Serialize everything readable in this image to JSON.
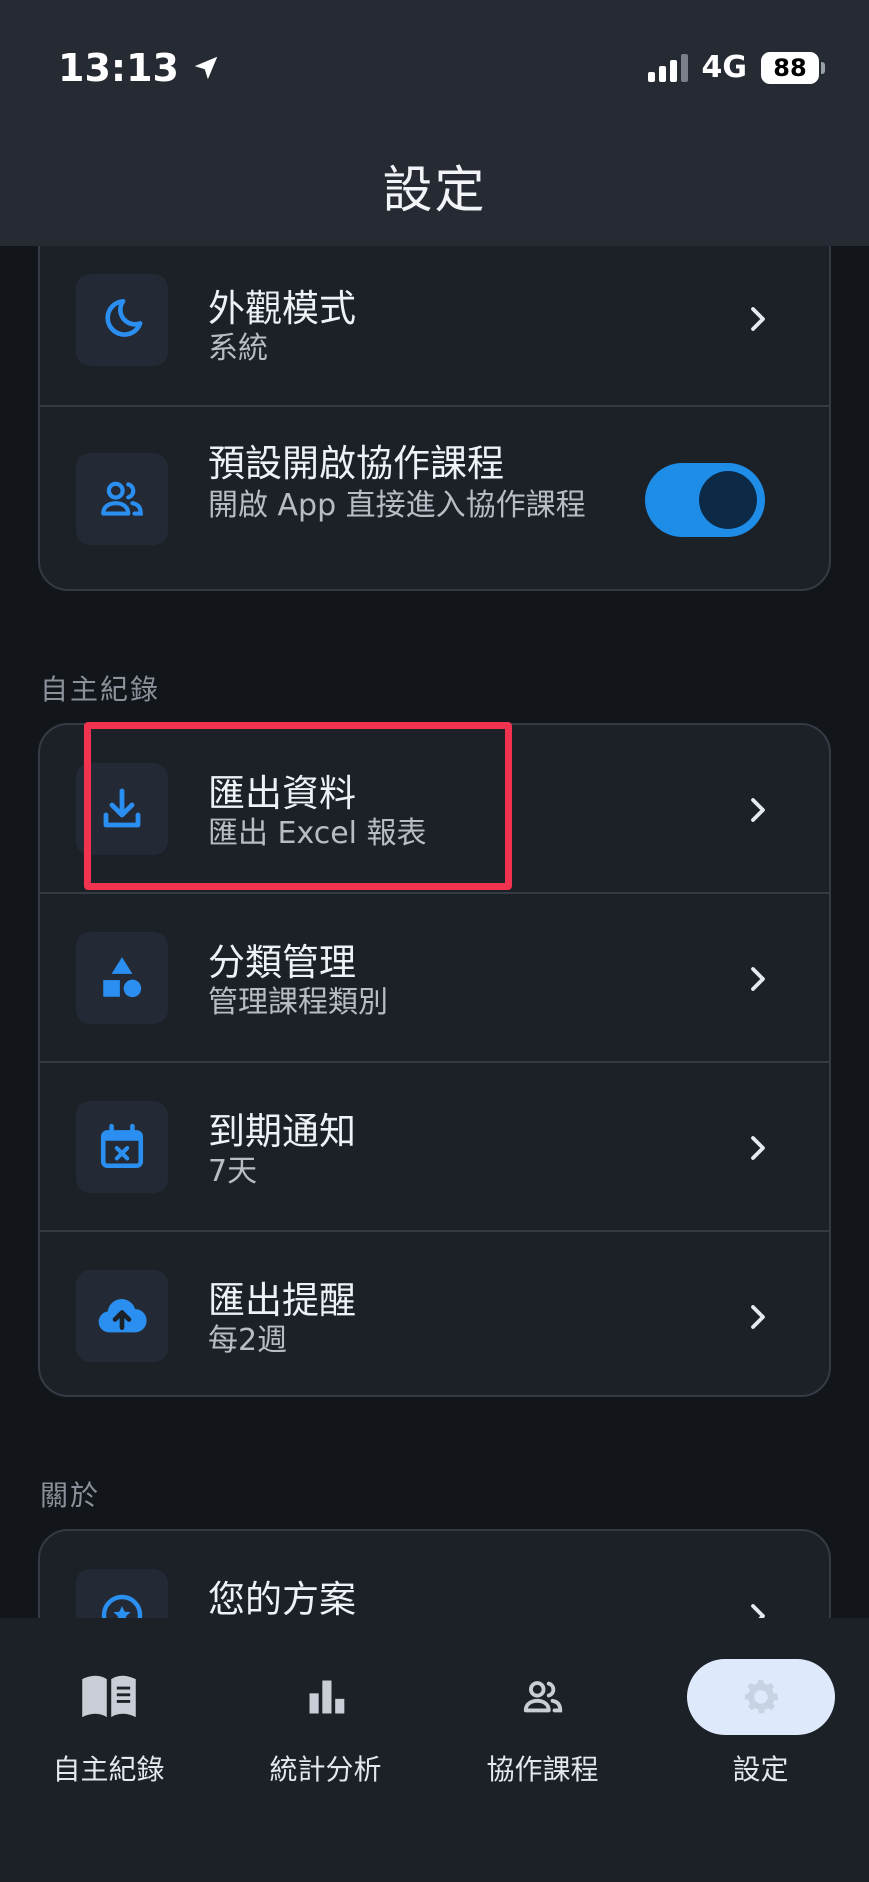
{
  "status_bar": {
    "time": "13:13",
    "network": "4G",
    "battery": "88"
  },
  "header": {
    "title": "設定"
  },
  "top_card": {
    "items": [
      {
        "title": "外觀模式",
        "subtitle": "系統",
        "icon": "moon-icon"
      },
      {
        "title": "預設開啟協作課程",
        "subtitle": "開啟 App 直接進入協作課程",
        "icon": "people-icon",
        "toggle": true
      }
    ]
  },
  "sections": {
    "records": {
      "label": "自主紀錄",
      "items": [
        {
          "title": "匯出資料",
          "subtitle": "匯出 Excel 報表",
          "icon": "download-icon"
        },
        {
          "title": "分類管理",
          "subtitle": "管理課程類別",
          "icon": "shapes-icon"
        },
        {
          "title": "到期通知",
          "subtitle": "7天",
          "icon": "calendar-x-icon"
        },
        {
          "title": "匯出提醒",
          "subtitle": "每2週",
          "icon": "cloud-upload-icon"
        }
      ]
    },
    "about": {
      "label": "關於",
      "items": [
        {
          "title": "您的方案",
          "icon": "star-badge-icon"
        }
      ]
    }
  },
  "tabbar": {
    "tabs": [
      {
        "label": "自主紀錄",
        "icon": "book-icon"
      },
      {
        "label": "統計分析",
        "icon": "bar-chart-icon"
      },
      {
        "label": "協作課程",
        "icon": "people-icon"
      },
      {
        "label": "設定",
        "icon": "gear-icon",
        "active": true
      }
    ]
  },
  "colors": {
    "accent": "#1e8de8",
    "highlight": "#f2334f",
    "background": "#121519",
    "card": "#1c2027"
  }
}
